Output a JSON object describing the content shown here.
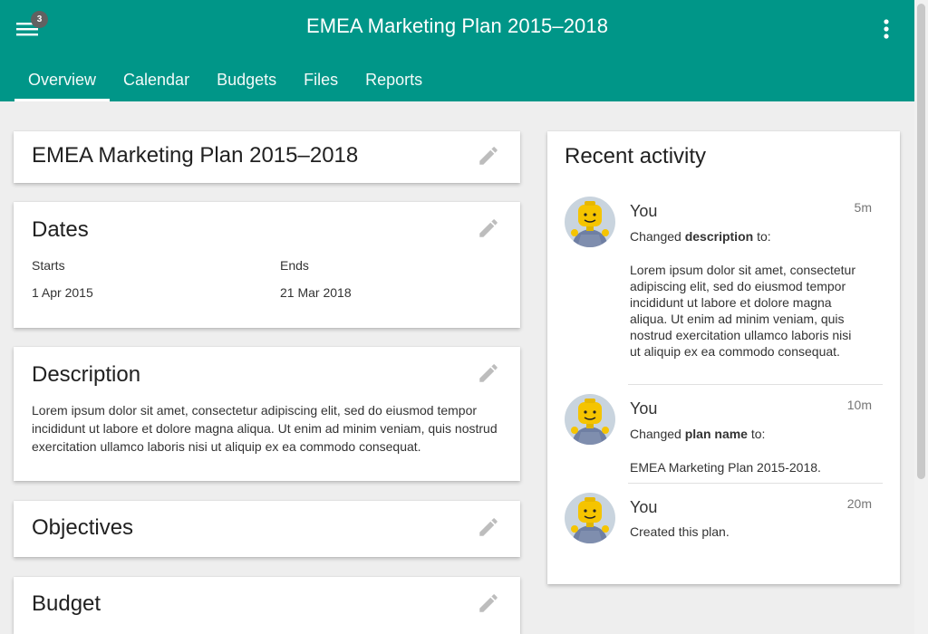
{
  "appbar": {
    "title": "EMEA Marketing Plan 2015–2018",
    "menu_badge": "3",
    "menu_icon": "hamburger-menu-icon",
    "more_icon": "more-vert-icon",
    "color": "#009688"
  },
  "tabs": [
    {
      "label": "Overview"
    },
    {
      "label": "Calendar"
    },
    {
      "label": "Budgets"
    },
    {
      "label": "Files"
    },
    {
      "label": "Reports"
    }
  ],
  "cards": {
    "plan_name": {
      "title": "EMEA Marketing Plan 2015–2018"
    },
    "dates": {
      "title": "Dates",
      "starts_label": "Starts",
      "starts_value": "1 Apr 2015",
      "ends_label": "Ends",
      "ends_value": "21 Mar 2018"
    },
    "description": {
      "title": "Description",
      "text": "Lorem ipsum dolor sit amet, consectetur adipiscing elit, sed do eiusmod tempor incididunt ut labore et dolore magna aliqua. Ut enim ad minim veniam, quis nostrud exercitation ullamco laboris nisi ut aliquip ex ea commodo consequat."
    },
    "objectives": {
      "title": "Objectives"
    },
    "budget": {
      "title": "Budget"
    }
  },
  "activity": {
    "title": "Recent activity",
    "items": [
      {
        "name": "You",
        "time": "5m",
        "desc_prefix": "Changed ",
        "desc_bold": "description",
        "desc_suffix": " to:",
        "body": "Lorem ipsum dolor sit amet, consectetur adipiscing elit, sed do eiusmod tempor incididunt ut labore et dolore magna aliqua. Ut enim ad minim veniam, quis nostrud exercitation ullamco laboris nisi ut aliquip ex ea commodo consequat."
      },
      {
        "name": "You",
        "time": "10m",
        "desc_prefix": "Changed ",
        "desc_bold": "plan name",
        "desc_suffix": " to:",
        "body": "EMEA Marketing Plan 2015-2018."
      },
      {
        "name": "You",
        "time": "20m",
        "desc_text": "Created this plan."
      }
    ]
  }
}
